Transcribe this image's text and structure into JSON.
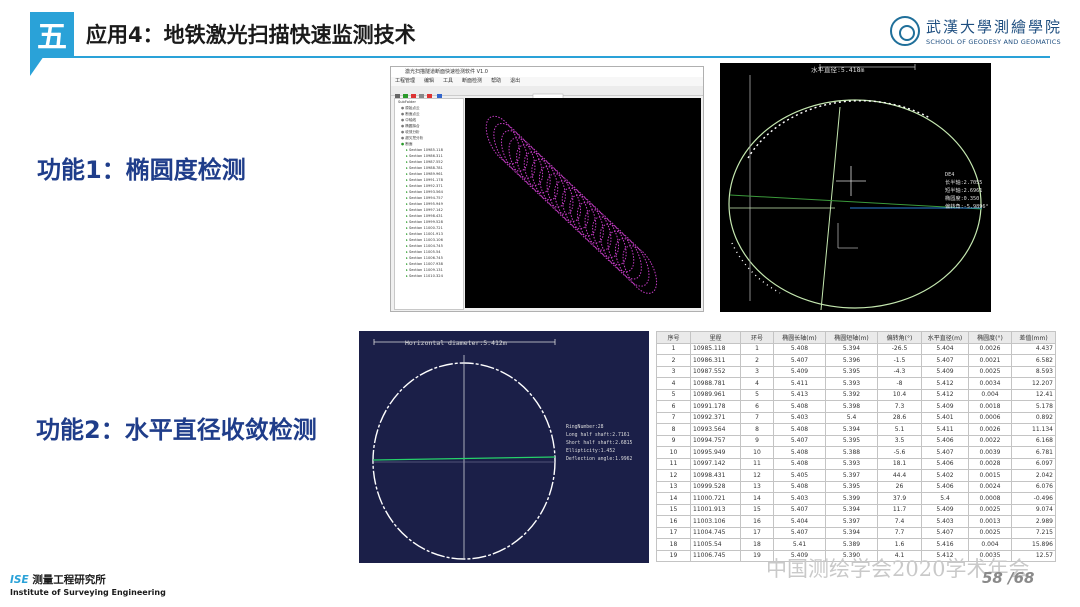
{
  "header": {
    "section_badge": "五",
    "title": "应用4：地铁激光扫描快速监测技术",
    "logo_cn": "武漢大學測繪學院",
    "logo_en": "SCHOOL OF GEODESY AND GEOMATICS"
  },
  "features": {
    "f1": "功能1：椭圆度检测",
    "f2": "功能2：水平直径收敛检测"
  },
  "software": {
    "window_title": "激光扫描隧道断面快速检测软件 V1.0",
    "menu": [
      "工程管理",
      "编辑",
      "工具",
      "断面检测",
      "帮助",
      "退出"
    ],
    "tree_root": "SubFolder",
    "tree_groups": [
      "原始点云",
      "断面点云",
      "中轴线",
      "椭圆拟合",
      "收敛分析",
      "超欠挖分析",
      "断面"
    ],
    "sections": [
      "Section 10985.118",
      "Section 10986.311",
      "Section 10987.552",
      "Section 10988.781",
      "Section 10989.961",
      "Section 10991.178",
      "Section 10992.371",
      "Section 10993.564",
      "Section 10994.757",
      "Section 10995.949",
      "Section 10997.142",
      "Section 10998.431",
      "Section 10999.528",
      "Section 11000.721",
      "Section 11001.913",
      "Section 11003.106",
      "Section 11004.745",
      "Section 11005.54",
      "Section 11006.745",
      "Section 11007.938",
      "Section 11009.131",
      "Section 11010.324"
    ]
  },
  "ellipse_panel": {
    "top_label": "水平直径:5.418m",
    "info": [
      "DE4",
      "长半轴:2.7055",
      "短半轴:2.6961",
      "椭圆度:0.350",
      "偏转角:-5.9896°"
    ]
  },
  "diameter_panel": {
    "top_label": "Horizontal diameter:5.412m",
    "info": [
      "RingNumber:28",
      "Long half shaft:2.7161",
      "Short half shaft:2.6815",
      "Ellipticity:1.452",
      "Deflection angle:1.9962"
    ]
  },
  "table": {
    "headers": [
      "序号",
      "里程",
      "环号",
      "椭圆长轴(m)",
      "椭圆短轴(m)",
      "偏转角(°)",
      "水平直径(m)",
      "椭圆度(°)",
      "差值(mm)"
    ],
    "rows": [
      [
        "1",
        "10985.118",
        "1",
        "5.408",
        "5.394",
        "-26.5",
        "5.404",
        "0.0026",
        "4.437"
      ],
      [
        "2",
        "10986.311",
        "2",
        "5.407",
        "5.396",
        "-1.5",
        "5.407",
        "0.0021",
        "6.582"
      ],
      [
        "3",
        "10987.552",
        "3",
        "5.409",
        "5.395",
        "-4.3",
        "5.409",
        "0.0025",
        "8.593"
      ],
      [
        "4",
        "10988.781",
        "4",
        "5.411",
        "5.393",
        "-8",
        "5.412",
        "0.0034",
        "12.207"
      ],
      [
        "5",
        "10989.961",
        "5",
        "5.413",
        "5.392",
        "10.4",
        "5.412",
        "0.004",
        "12.41"
      ],
      [
        "6",
        "10991.178",
        "6",
        "5.408",
        "5.398",
        "7.3",
        "5.409",
        "0.0018",
        "5.178"
      ],
      [
        "7",
        "10992.371",
        "7",
        "5.403",
        "5.4",
        "28.6",
        "5.401",
        "0.0006",
        "0.892"
      ],
      [
        "8",
        "10993.564",
        "8",
        "5.408",
        "5.394",
        "5.1",
        "5.411",
        "0.0026",
        "11.134"
      ],
      [
        "9",
        "10994.757",
        "9",
        "5.407",
        "5.395",
        "3.5",
        "5.406",
        "0.0022",
        "6.168"
      ],
      [
        "10",
        "10995.949",
        "10",
        "5.408",
        "5.388",
        "-5.6",
        "5.407",
        "0.0039",
        "6.781"
      ],
      [
        "11",
        "10997.142",
        "11",
        "5.408",
        "5.393",
        "18.1",
        "5.406",
        "0.0028",
        "6.097"
      ],
      [
        "12",
        "10998.431",
        "12",
        "5.405",
        "5.397",
        "44.4",
        "5.402",
        "0.0015",
        "2.042"
      ],
      [
        "13",
        "10999.528",
        "13",
        "5.408",
        "5.395",
        "26",
        "5.406",
        "0.0024",
        "6.076"
      ],
      [
        "14",
        "11000.721",
        "14",
        "5.403",
        "5.399",
        "37.9",
        "5.4",
        "0.0008",
        "-0.496"
      ],
      [
        "15",
        "11001.913",
        "15",
        "5.407",
        "5.394",
        "11.7",
        "5.409",
        "0.0025",
        "9.074"
      ],
      [
        "16",
        "11003.106",
        "16",
        "5.404",
        "5.397",
        "7.4",
        "5.403",
        "0.0013",
        "2.989"
      ],
      [
        "17",
        "11004.745",
        "17",
        "5.407",
        "5.394",
        "7.7",
        "5.407",
        "0.0025",
        "7.215"
      ],
      [
        "18",
        "11005.54",
        "18",
        "5.41",
        "5.389",
        "1.6",
        "5.416",
        "0.004",
        "15.896"
      ],
      [
        "19",
        "11006.745",
        "19",
        "5.409",
        "5.390",
        "4.1",
        "5.412",
        "0.0035",
        "12.57"
      ]
    ]
  },
  "watermark": "中国测绘学会2020学术年会",
  "page_number": "58 /68",
  "footer": {
    "ise": "ISE",
    "cn": "测量工程研究所",
    "en": "Institute of Surveying Engineering"
  },
  "colors": {
    "accent": "#2aa2d8",
    "feature_text": "#1f3d8a",
    "scan_points": "#c83cc8",
    "fit_circle": "#b6e8a6"
  }
}
